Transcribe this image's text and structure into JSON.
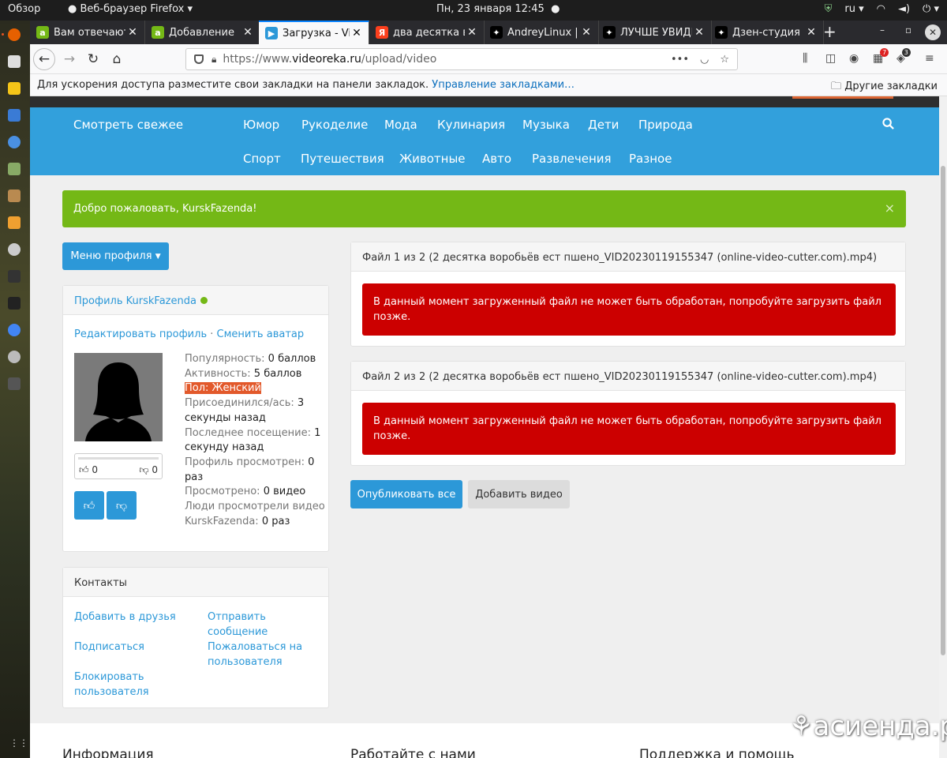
{
  "topbar": {
    "activities": "Обзор",
    "app": "Веб-браузер Firefox",
    "clock": "Пн, 23 января  12:45",
    "lang": "ru"
  },
  "tabs": [
    {
      "title": "Вам отвечают",
      "icon": "a",
      "color": "#74b816"
    },
    {
      "title": "Добавление",
      "icon": "a",
      "color": "#74b816"
    },
    {
      "title": "Загрузка - Vid",
      "icon": "▶",
      "color": "#2c98d8"
    },
    {
      "title": "два десятка в",
      "icon": "Я",
      "color": "#fc3f1d"
    },
    {
      "title": "AndreyLinux |",
      "icon": "✦",
      "color": "#000000"
    },
    {
      "title": "ЛУЧШЕ УВИДЕ",
      "icon": "✦",
      "color": "#000000"
    },
    {
      "title": "Дзен-студия",
      "icon": "✦",
      "color": "#000000"
    }
  ],
  "url": {
    "prefix": "https://www.",
    "domain": "videoreka.ru",
    "path": "/upload/video"
  },
  "toolbar_badges": {
    "a": "7",
    "b": "3"
  },
  "bookmarks": {
    "message": "Для ускорения доступа разместите свои закладки на панели закладок.",
    "manage": "Управление закладками…",
    "other": "Другие закладки"
  },
  "nav": {
    "fresh": "Смотреть свежее",
    "row1": [
      "Юмор",
      "Рукоделие",
      "Мода",
      "Кулинария",
      "Музыка",
      "Дети",
      "Природа"
    ],
    "row2": [
      "Спорт",
      "Путешествия",
      "Животные",
      "Авто",
      "Развлечения",
      "Разное"
    ]
  },
  "welcome": "Добро пожаловать, KurskFazenda!",
  "profile_menu": "Меню профиля",
  "profile": {
    "title": "Профиль KurskFazenda",
    "edit": "Редактировать профиль",
    "sep": "·",
    "avatar": "Сменить аватар",
    "likes": "0",
    "dislikes": "0",
    "stats": {
      "popularity_label": "Популярность:",
      "popularity": "0 баллов",
      "activity_label": "Активность:",
      "activity": "5 баллов",
      "gender": "Пол: Женский",
      "joined_label": "Присоединился/ась:",
      "joined": "3 секунды назад",
      "last_label": "Последнее посещение:",
      "last": "1 секунду назад",
      "viewed_label": "Профиль просмотрен:",
      "viewed": "0 раз",
      "watched_label": "Просмотрено:",
      "watched": "0 видео",
      "people_label": "Люди просмотрели видео KurskFazenda:",
      "people": "0 раз"
    }
  },
  "contacts": {
    "title": "Контакты",
    "add_friend": "Добавить в друзья",
    "send_message": "Отправить сообщение",
    "subscribe": "Подписаться",
    "report": "Пожаловаться на пользователя",
    "block": "Блокировать пользователя"
  },
  "files": [
    {
      "title": "Файл 1 из 2 (2 десятка воробьёв ест пшено_VID20230119155347 (online-video-cutter.com).mp4)",
      "error": "В данный момент загруженный файл не может быть обработан, попробуйте загрузить файл позже."
    },
    {
      "title": "Файл 2 из 2 (2 десятка воробьёв ест пшено_VID20230119155347 (online-video-cutter.com).mp4)",
      "error": "В данный момент загруженный файл не может быть обработан, попробуйте загрузить файл позже."
    }
  ],
  "buttons": {
    "publish": "Опубликовать все",
    "add": "Добавить видео"
  },
  "footer": {
    "info": "Информация",
    "work": "Работайте с нами",
    "support": "Поддержка и помощь"
  },
  "watermark": "асиенда.ру",
  "colors": {
    "accent": "#32a0dc",
    "success": "#74b816",
    "error": "#cc0000",
    "highlight": "#e2592b"
  }
}
